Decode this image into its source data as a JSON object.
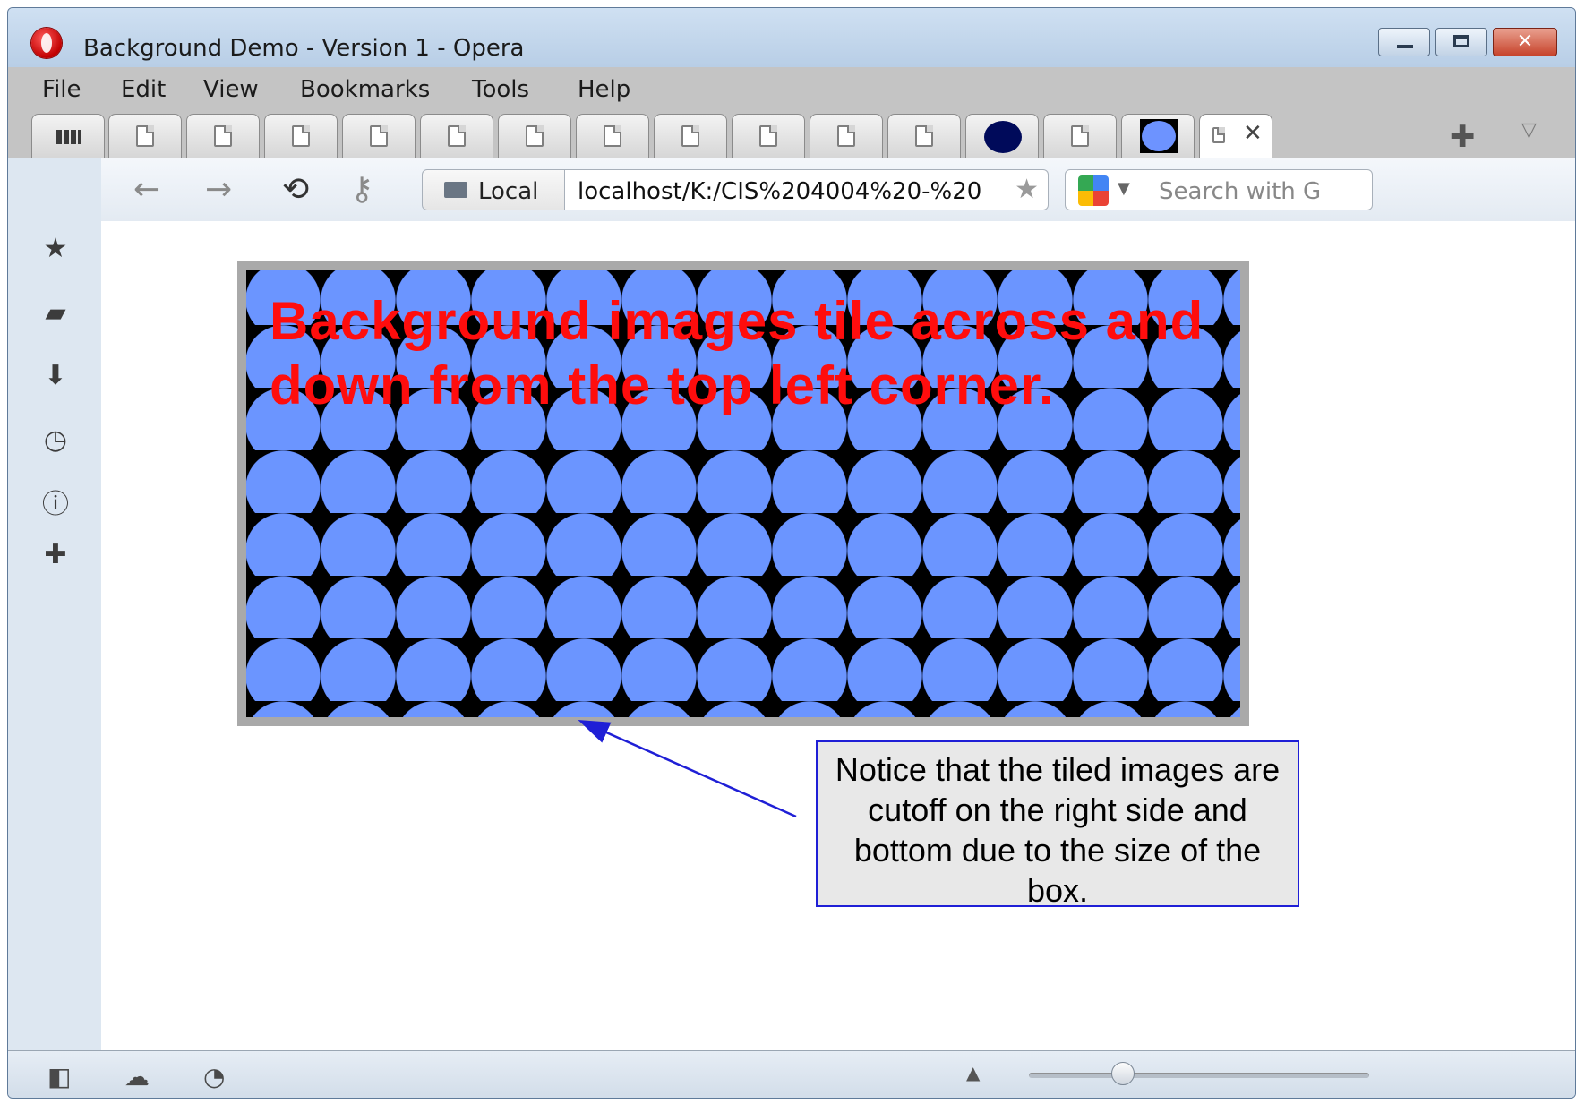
{
  "window": {
    "title": "Background Demo - Version 1 - Opera",
    "buttons": [
      "minimize",
      "maximize",
      "close"
    ],
    "close_glyph": "✕"
  },
  "menu": {
    "items": [
      "File",
      "Edit",
      "View",
      "Bookmarks",
      "Tools",
      "Help"
    ]
  },
  "tabs": {
    "count_doc_tabs": 12,
    "active_tab_close": "✕",
    "new_tab_glyph": "✚",
    "tab_menu_glyph": "▽"
  },
  "address": {
    "back": "←",
    "forward": "→",
    "reload": "⟲",
    "key": "⚷",
    "site_badge": "Local",
    "url": "localhost/K:/CIS%204004%20-%20",
    "bookmark_star": "★",
    "search_placeholder": "Search with G"
  },
  "sidebar": {
    "icons": [
      "bookmarks-icon",
      "notes-icon",
      "downloads-icon",
      "history-icon",
      "info-icon",
      "add-panel-icon"
    ]
  },
  "content": {
    "demo_text": "Background images tile across and down from the top left corner.",
    "tile_colors": {
      "circle": "#6b95ff",
      "background": "#000000",
      "text": "#ff0d0d",
      "border": "#a9a9a9"
    }
  },
  "annotation": {
    "callout_text": "Notice that the tiled images are cutoff on the right side and bottom due to the size of the box.",
    "color": "#1f1fd6"
  },
  "statusbar": {
    "icons": [
      "panel-toggle-icon",
      "unite-cloud-icon",
      "turbo-gauge-icon",
      "zoom-up-icon"
    ],
    "zoom_level_fraction": 0.3
  }
}
